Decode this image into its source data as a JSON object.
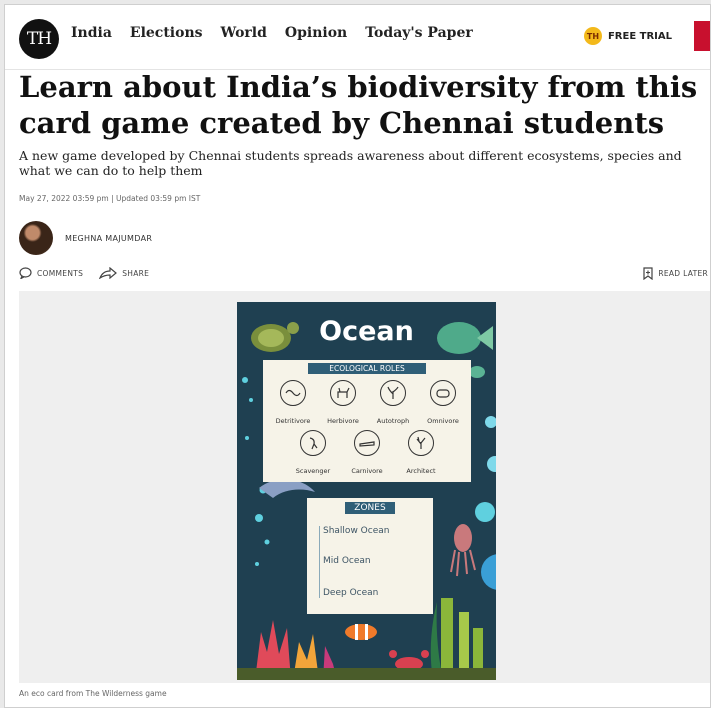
{
  "nav": {
    "logo": "TH",
    "links": [
      "India",
      "Elections",
      "World",
      "Opinion",
      "Today's Paper"
    ],
    "trial_badge": "TH",
    "trial_label": "FREE TRIAL"
  },
  "article": {
    "headline": "Learn about India’s biodiversity from this card game created by Chennai students",
    "subhead": "A new game developed by Chennai students spreads awareness about different ecosystems, species and what we can do to help them",
    "date": "May 27, 2022 03:59 pm | Updated 03:59 pm IST",
    "author": "MEGHNA MAJUMDAR",
    "comments_label": "COMMENTS",
    "share_label": "SHARE",
    "read_later_label": "READ LATER",
    "caption": "An eco card from The Wilderness game"
  },
  "card": {
    "title": "Ocean",
    "roles_heading": "ECOLOGICAL ROLES",
    "roles": [
      "Detritivore",
      "Herbivore",
      "Autotroph",
      "Omnivore",
      "Scavenger",
      "Carnivore",
      "Architect"
    ],
    "zones_heading": "ZONES",
    "zones": [
      "Shallow Ocean",
      "Mid Ocean",
      "Deep Ocean"
    ]
  },
  "colors": {
    "brand_red": "#c8102e",
    "card_bg": "#1f4051",
    "card_panel": "#f6f3e8",
    "trial_badge": "#f3b91b"
  }
}
